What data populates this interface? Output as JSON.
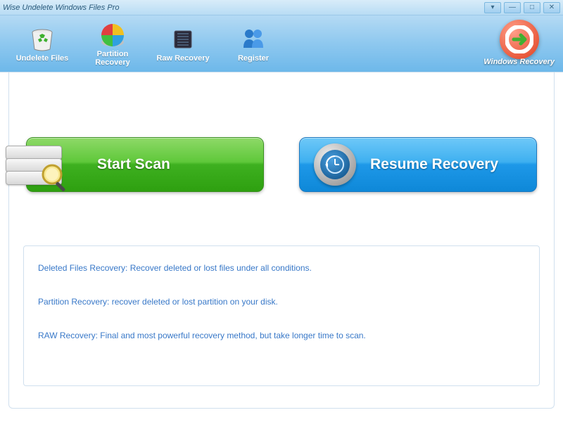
{
  "window": {
    "title": "Wise Undelete Windows Files Pro"
  },
  "toolbar": {
    "items": [
      {
        "label": "Undelete Files"
      },
      {
        "label": "Partition\nRecovery"
      },
      {
        "label": "Raw Recovery"
      },
      {
        "label": "Register"
      }
    ]
  },
  "brand": {
    "label": "Windows Recovery"
  },
  "main": {
    "start_scan": "Start  Scan",
    "resume_recovery": "Resume Recovery"
  },
  "info": {
    "line1": "Deleted Files Recovery: Recover deleted or lost files  under all conditions.",
    "line2": "Partition Recovery: recover deleted or lost partition on your disk.",
    "line3": "RAW Recovery: Final and most powerful recovery method, but take longer time to scan."
  }
}
